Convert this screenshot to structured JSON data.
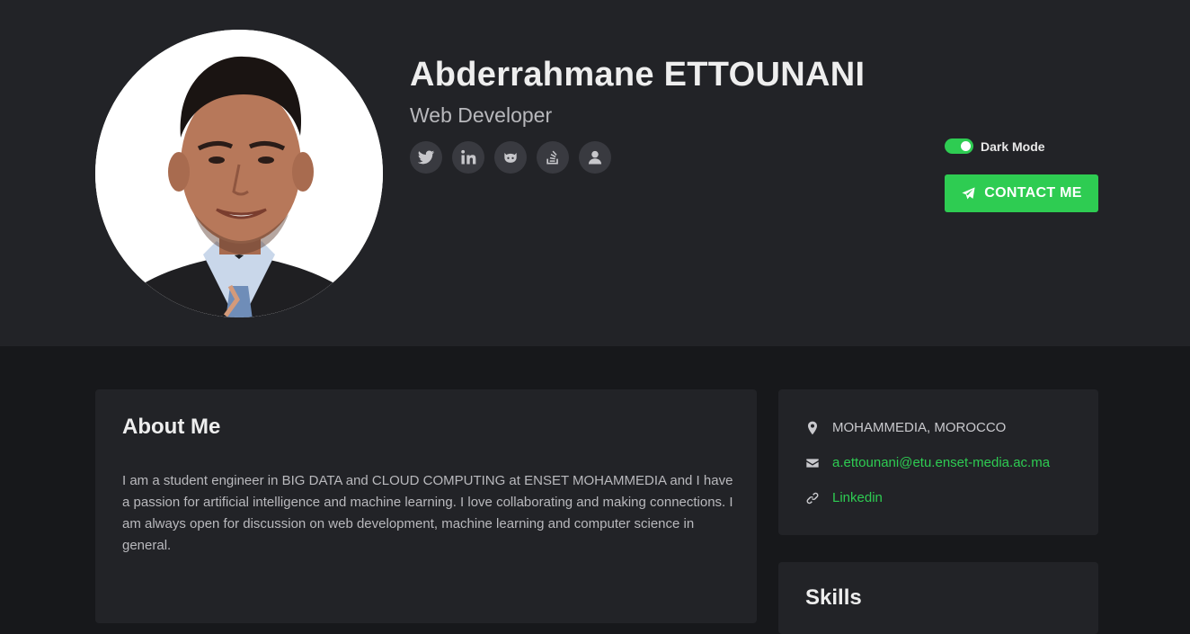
{
  "profile": {
    "name": "Abderrahmane ETTOUNANI",
    "role": "Web Developer"
  },
  "socials": [
    {
      "name": "twitter",
      "icon": "twitter-icon"
    },
    {
      "name": "linkedin",
      "icon": "linkedin-icon"
    },
    {
      "name": "github",
      "icon": "github-icon"
    },
    {
      "name": "stackoverflow",
      "icon": "stackoverflow-icon"
    },
    {
      "name": "user",
      "icon": "user-icon"
    }
  ],
  "theme": {
    "dark_mode_label": "Dark Mode",
    "dark_mode_enabled": true,
    "accent": "#2ecc52",
    "header_bg": "#222327",
    "page_bg": "#17181b"
  },
  "contact": {
    "label": "CONTACT ME",
    "icon": "paper-plane-icon"
  },
  "about": {
    "title": "About Me",
    "text": "I am a student engineer in BIG DATA and CLOUD COMPUTING at ENSET MOHAMMEDIA and I have a passion for artificial intelligence and machine learning. I love collaborating and making connections. I am always open for discussion on web development, machine learning and computer science in general."
  },
  "info": {
    "location": "MOHAMMEDIA, MOROCCO",
    "email": "a.ettounani@etu.enset-media.ac.ma",
    "link": "Linkedin"
  },
  "skills": {
    "title": "Skills"
  }
}
